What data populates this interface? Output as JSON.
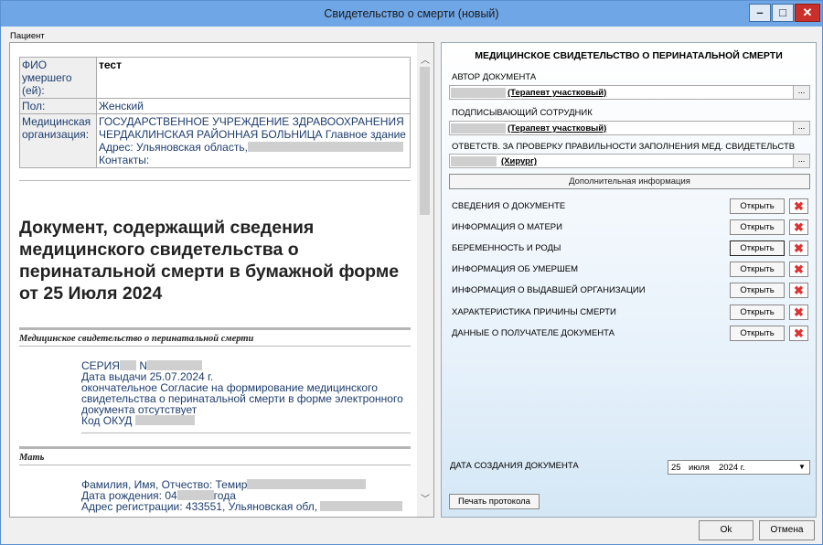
{
  "window": {
    "title": "Свидетельство о смерти (новый)",
    "minimize": "–",
    "maximize": "□",
    "close": "✕"
  },
  "patient_label": "Пациент",
  "left": {
    "fio_label": "ФИО умершего (ей):",
    "fio_value": "тест",
    "sex_label": "Пол:",
    "sex_value": "Женский",
    "org_label": "Медицинская организация:",
    "org_line1": "ГОСУДАРСТВЕННОЕ УЧРЕЖДЕНИЕ ЗДРАВООХРАНЕНИЯ",
    "org_line2": "ЧЕРДАКЛИНСКАЯ РАЙОННАЯ БОЛЬНИЦА Главное здание",
    "org_address": "Адрес: Ульяновская область,",
    "org_contacts": "Контакты:",
    "doc_title": "Документ, содержащий сведения медицинского свидетельства о перинатальной смерти в бумажной форме от 25 Июля 2024",
    "section1": "Медицинское свидетельство о перинатальной смерти",
    "series_label": "СЕРИЯ",
    "number_label": "N",
    "issue_date": "Дата выдачи 25.07.2024 г.",
    "final_line1": "окончательное Согласие на формирование медицинского",
    "final_line2": "свидетельства о перинатальной смерти в форме электронного",
    "final_line3": "документа отсутствует",
    "okud_label": "Код ОКУД",
    "section2": "Мать",
    "mother_name": "Фамилия, Имя, Отчество: Темир",
    "mother_birth_prefix": "Дата рождения: 04",
    "mother_birth_suffix": "года",
    "mother_reg": "Адрес регистрации: 433551, Ульяновская обл,"
  },
  "right": {
    "title": "МЕДИЦИНСКОЕ СВИДЕТЕЛЬСТВО О ПЕРИНАТАЛЬНОЙ СМЕРТИ",
    "author_label": "АВТОР ДОКУМЕНТА",
    "author_value": "(Терапевт участковый)",
    "signer_label": "ПОДПИСЫВАЮЩИЙ СОТРУДНИК",
    "signer_value": "(Терапевт участковый)",
    "checker_label": "ОТВЕТСТВ. ЗА ПРОВЕРКУ ПРАВИЛЬНОСТИ ЗАПОЛНЕНИЯ МЕД. СВИДЕТЕЛЬСТВ",
    "checker_value": "(Хирург)",
    "dots": "...",
    "additional_info": "Дополнительная информация",
    "open_label": "Открыть",
    "sections": [
      "СВЕДЕНИЯ О ДОКУМЕНТЕ",
      "ИНФОРМАЦИЯ О МАТЕРИ",
      "БЕРЕМЕННОСТЬ И РОДЫ",
      "ИНФОРМАЦИЯ ОБ УМЕРШЕМ",
      "ИНФОРМАЦИЯ О ВЫДАВШЕЙ ОРГАНИЗАЦИИ",
      "ХАРАКТЕРИСТИКА ПРИЧИНЫ СМЕРТИ",
      "ДАННЫЕ О ПОЛУЧАТЕЛЕ ДОКУМЕНТА"
    ],
    "date_label": "ДАТА СОЗДАНИЯ ДОКУМЕНТА",
    "date_day": "25",
    "date_month": "июля",
    "date_year": "2024 г.",
    "print_protocol": "Печать протокола"
  },
  "footer": {
    "ok": "Ok",
    "cancel": "Отмена"
  }
}
